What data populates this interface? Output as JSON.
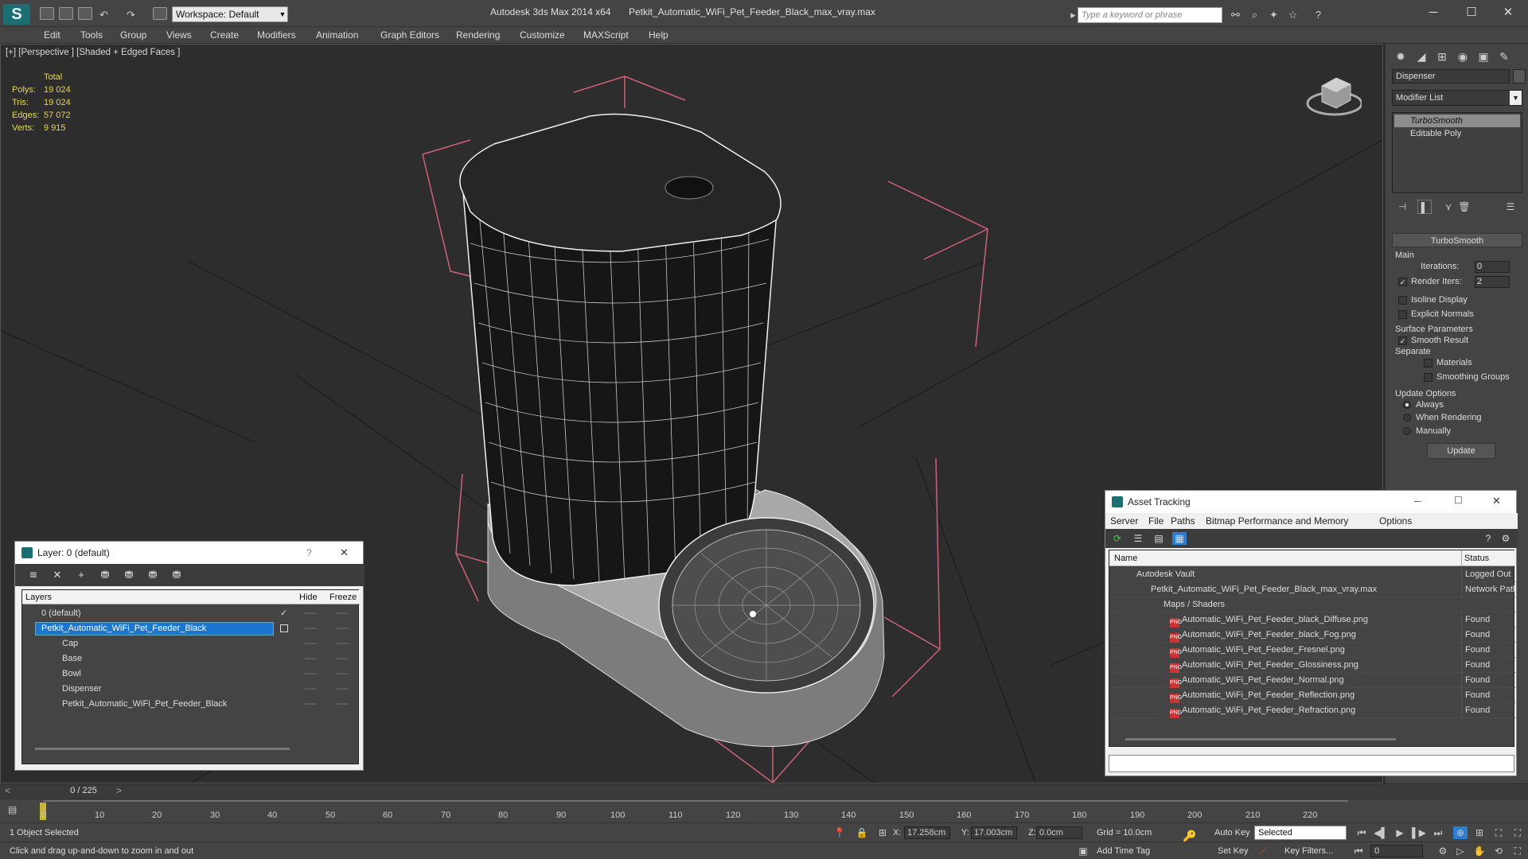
{
  "titlebar": {
    "app_title": "Autodesk 3ds Max  2014 x64",
    "file_title": "Petkit_Automatic_WiFi_Pet_Feeder_Black_max_vray.max",
    "workspace": "Workspace: Default",
    "search_placeholder": "Type a keyword or phrase",
    "logo": "S"
  },
  "menu": [
    "Edit",
    "Tools",
    "Group",
    "Views",
    "Create",
    "Modifiers",
    "Animation",
    "Graph Editors",
    "Rendering",
    "Customize",
    "MAXScript",
    "Help"
  ],
  "viewport": {
    "label": "[+] [Perspective ] [Shaded + Edged Faces ]",
    "stats": {
      "header": "Total",
      "rows": [
        {
          "k": "Polys:",
          "v": "19 024"
        },
        {
          "k": "Tris:",
          "v": "19 024"
        },
        {
          "k": "Edges:",
          "v": "57 072"
        },
        {
          "k": "Verts:",
          "v": "9 915"
        }
      ]
    }
  },
  "command_panel": {
    "object_name": "Dispenser",
    "modifier_list": "Modifier List",
    "stack": [
      "TurboSmooth",
      "Editable Poly"
    ],
    "rollout_title": "TurboSmooth",
    "main_label": "Main",
    "iterations_label": "Iterations:",
    "iterations_value": "0",
    "render_iters_label": "Render Iters:",
    "render_iters_value": "2",
    "isoline": "Isoline Display",
    "explicit_normals": "Explicit Normals",
    "surface_params": "Surface Parameters",
    "smooth_result": "Smooth Result",
    "separate": "Separate",
    "materials": "Materials",
    "smoothing_groups": "Smoothing Groups",
    "update_options": "Update Options",
    "always": "Always",
    "when_rendering": "When Rendering",
    "manually": "Manually",
    "update_button": "Update"
  },
  "layer_window": {
    "title": "Layer: 0 (default)",
    "help": "?",
    "close": "✕",
    "col_layers": "Layers",
    "col_hide": "Hide",
    "col_freeze": "Freeze",
    "rows": [
      {
        "name": "0 (default)",
        "hide": "----",
        "freeze": "----"
      },
      {
        "name": "Petkit_Automatic_WiFi_Pet_Feeder_Black",
        "hide": "----",
        "freeze": "----"
      },
      {
        "name": "Cap",
        "hide": "----",
        "freeze": "----"
      },
      {
        "name": "Base",
        "hide": "----",
        "freeze": "----"
      },
      {
        "name": "Bowl",
        "hide": "----",
        "freeze": "----"
      },
      {
        "name": "Dispenser",
        "hide": "----",
        "freeze": "----"
      },
      {
        "name": "Petkit_Automatic_WiFi_Pet_Feeder_Black",
        "hide": "----",
        "freeze": "----"
      }
    ]
  },
  "asset_window": {
    "title": "Asset Tracking",
    "menu": [
      "Server",
      "File",
      "Paths",
      "Bitmap Performance and Memory",
      "Options"
    ],
    "col_name": "Name",
    "col_status": "Status",
    "rows": [
      {
        "name": "Autodesk Vault",
        "status": "Logged Out"
      },
      {
        "name": "Petkit_Automatic_WiFi_Pet_Feeder_Black_max_vray.max",
        "status": "Network Path"
      },
      {
        "name": "Maps / Shaders",
        "status": ""
      },
      {
        "name": "Automatic_WiFi_Pet_Feeder_black_Diffuse.png",
        "status": "Found"
      },
      {
        "name": "Automatic_WiFi_Pet_Feeder_black_Fog.png",
        "status": "Found"
      },
      {
        "name": "Automatic_WiFi_Pet_Feeder_Fresnel.png",
        "status": "Found"
      },
      {
        "name": "Automatic_WiFi_Pet_Feeder_Glossiness.png",
        "status": "Found"
      },
      {
        "name": "Automatic_WiFi_Pet_Feeder_Normal.png",
        "status": "Found"
      },
      {
        "name": "Automatic_WiFi_Pet_Feeder_Reflection.png",
        "status": "Found"
      },
      {
        "name": "Automatic_WiFi_Pet_Feeder_Refraction.png",
        "status": "Found"
      }
    ],
    "png_badge": "PNG"
  },
  "timeline": {
    "frame_counter": "0 / 225",
    "ticks": [
      "0",
      "10",
      "20",
      "30",
      "40",
      "50",
      "60",
      "70",
      "80",
      "90",
      "100",
      "110",
      "120",
      "130",
      "140",
      "150",
      "160",
      "170",
      "180",
      "190",
      "200",
      "210",
      "220"
    ]
  },
  "status": {
    "selection": "1 Object Selected",
    "hint": "Click and drag up-and-down to zoom in and out",
    "x_label": "X:",
    "x_value": "17.258cm",
    "y_label": "Y:",
    "y_value": "17.003cm",
    "z_label": "Z:",
    "z_value": "0.0cm",
    "grid": "Grid = 10.0cm",
    "add_time_tag": "Add Time Tag",
    "auto_key": "Auto Key",
    "set_key": "Set Key",
    "selected": "Selected",
    "key_filters": "Key Filters...",
    "frame_value": "0"
  }
}
